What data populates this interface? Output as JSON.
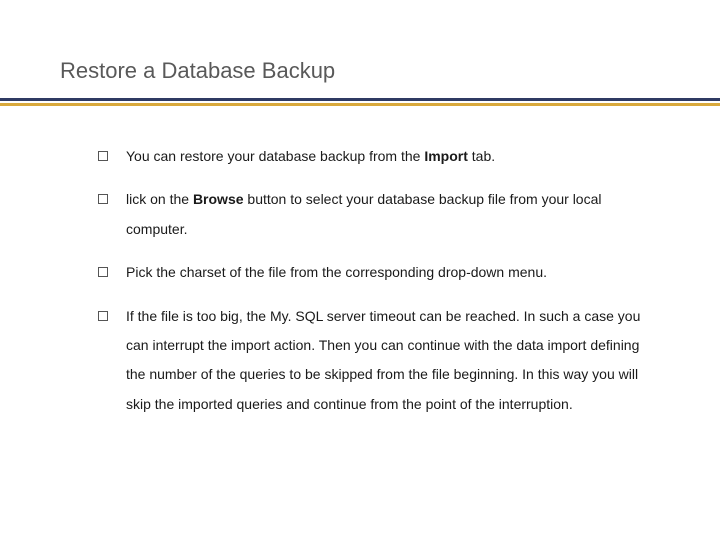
{
  "title": "Restore a Database Backup",
  "items": {
    "i0": {
      "a": "You can restore your database backup from the ",
      "b": "Import",
      "c": " tab."
    },
    "i1": {
      "a": "lick on the ",
      "b": "Browse",
      "c": " button to select your database backup file from your local computer."
    },
    "i2": {
      "a": "Pick the charset of the file from the corresponding drop-down menu."
    },
    "i3": {
      "a": "If the file is too big, the My. SQL server timeout can be reached. In such a case you can interrupt the import action. Then you can continue with the data import defining the number of the queries to be skipped from the file beginning. In this way you will skip the imported queries and continue from the point of the interruption."
    }
  }
}
